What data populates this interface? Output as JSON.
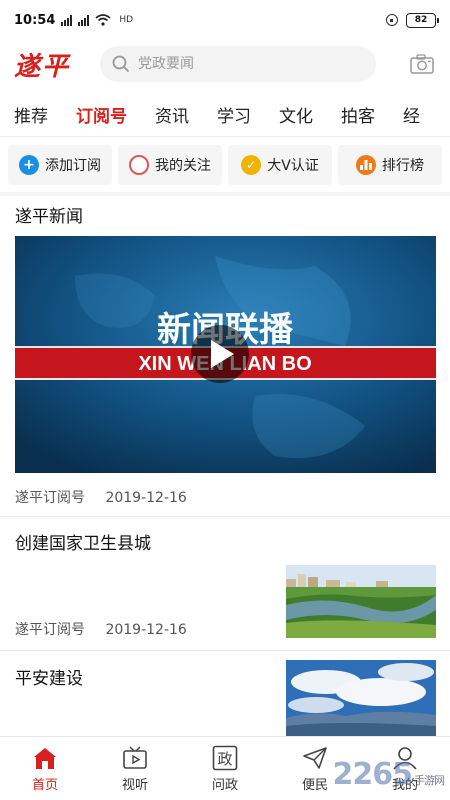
{
  "status_bar": {
    "time": "10:54",
    "network": "HD",
    "battery": "82"
  },
  "header": {
    "logo": "遂平",
    "search_placeholder": "党政要闻"
  },
  "tabs": [
    "推荐",
    "订阅号",
    "资讯",
    "学习",
    "文化",
    "拍客",
    "经"
  ],
  "actions": [
    {
      "label": "添加订阅",
      "icon": "plus-icon",
      "color": "#1a8fe6"
    },
    {
      "label": "我的关注",
      "icon": "circle-icon",
      "color": "#e0555a"
    },
    {
      "label": "大V认证",
      "icon": "check-icon",
      "color": "#f0b400"
    },
    {
      "label": "排行榜",
      "icon": "chart-icon",
      "color": "#f07a1a"
    }
  ],
  "feed": [
    {
      "title": "遂平新闻",
      "source": "遂平订阅号",
      "date": "2019-12-16",
      "video_caption": "新闻联播",
      "video_subcaption": "XIN WEN LIAN BO"
    },
    {
      "title": "创建国家卫生县城",
      "source": "遂平订阅号",
      "date": "2019-12-16"
    },
    {
      "title": "平安建设"
    }
  ],
  "bottom_nav": [
    {
      "label": "首页",
      "icon": "home-icon"
    },
    {
      "label": "视听",
      "icon": "tv-icon"
    },
    {
      "label": "问政",
      "icon": "ask-icon"
    },
    {
      "label": "便民",
      "icon": "send-icon"
    },
    {
      "label": "我的",
      "icon": "user-icon"
    }
  ],
  "watermark": {
    "text": "2265",
    "sub": "手游网"
  },
  "colors": {
    "accent": "#d8201c"
  }
}
